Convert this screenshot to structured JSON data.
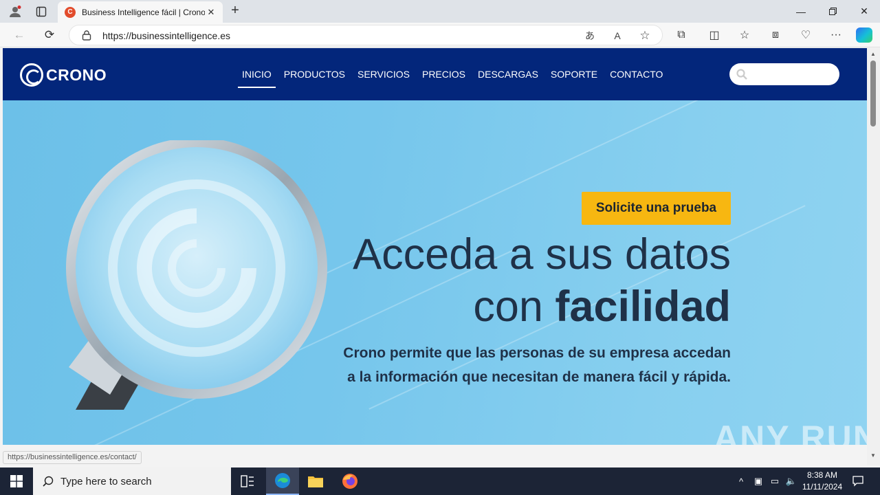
{
  "browser": {
    "tab_title": "Business Intelligence fácil | Crono",
    "tab_favicon_letter": "C",
    "url": "https://businessintelligence.es",
    "status_url": "https://businessintelligence.es/contact/"
  },
  "site": {
    "logo_text": "CRONO",
    "nav": [
      {
        "label": "INICIO",
        "active": true
      },
      {
        "label": "PRODUCTOS"
      },
      {
        "label": "SERVICIOS"
      },
      {
        "label": "PRECIOS"
      },
      {
        "label": "DESCARGAS"
      },
      {
        "label": "SOPORTE"
      },
      {
        "label": "CONTACTO"
      }
    ],
    "search_placeholder": ""
  },
  "hero": {
    "cta": "Solicite una prueba",
    "headline_line1": "Acceda a sus datos",
    "headline_line2_pre": "con ",
    "headline_line2_bold": "facilidad",
    "sub_line1": "Crono permite que las personas de su empresa accedan",
    "sub_line2": "a la información que necesitan de manera fácil y rápida."
  },
  "watermark": "ANY RUN",
  "taskbar": {
    "search_text": "Type here to search",
    "time": "8:38 AM",
    "date": "11/11/2024"
  },
  "colors": {
    "header": "#03267b",
    "cta": "#f7b711",
    "hero": "#76c6ec"
  }
}
